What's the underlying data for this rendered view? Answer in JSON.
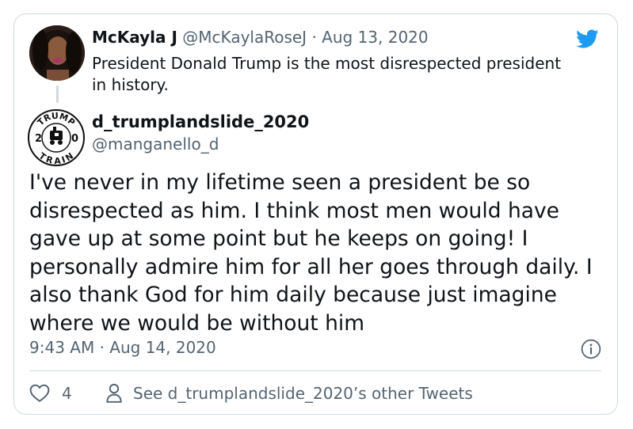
{
  "quoted_tweet": {
    "name": "McKayla J",
    "handle": "@McKaylaRoseJ",
    "separator": "·",
    "date": "Aug 13, 2020",
    "text": "President Donald Trump is the most disrespected president in history."
  },
  "author": {
    "name": "d_trumplandslide_2020",
    "handle": "@manganello_d",
    "avatar_top_text": "TRUMP",
    "avatar_bottom_text": "TRAIN",
    "avatar_left_digit": "2",
    "avatar_right_digit": "0"
  },
  "tweet": {
    "text": "I've never in my lifetime seen a president be so disrespected as him. I think most men would have gave up at some point but he keeps on going! I personally admire him for all her goes through daily. I also thank God for him daily because just imagine where we would be without him",
    "timestamp": "9:43 AM · Aug 14, 2020"
  },
  "footer": {
    "like_count": "4",
    "other_tweets_label": "See d_trumplandslide_2020’s other Tweets"
  },
  "icons": {
    "brand": "twitter-bird-icon",
    "info": "info-icon",
    "like": "heart-icon",
    "profile": "person-icon"
  },
  "colors": {
    "twitter_blue": "#1d9bf0",
    "text_primary": "#0f1419",
    "text_secondary": "#536471",
    "border": "#cfd9de"
  }
}
